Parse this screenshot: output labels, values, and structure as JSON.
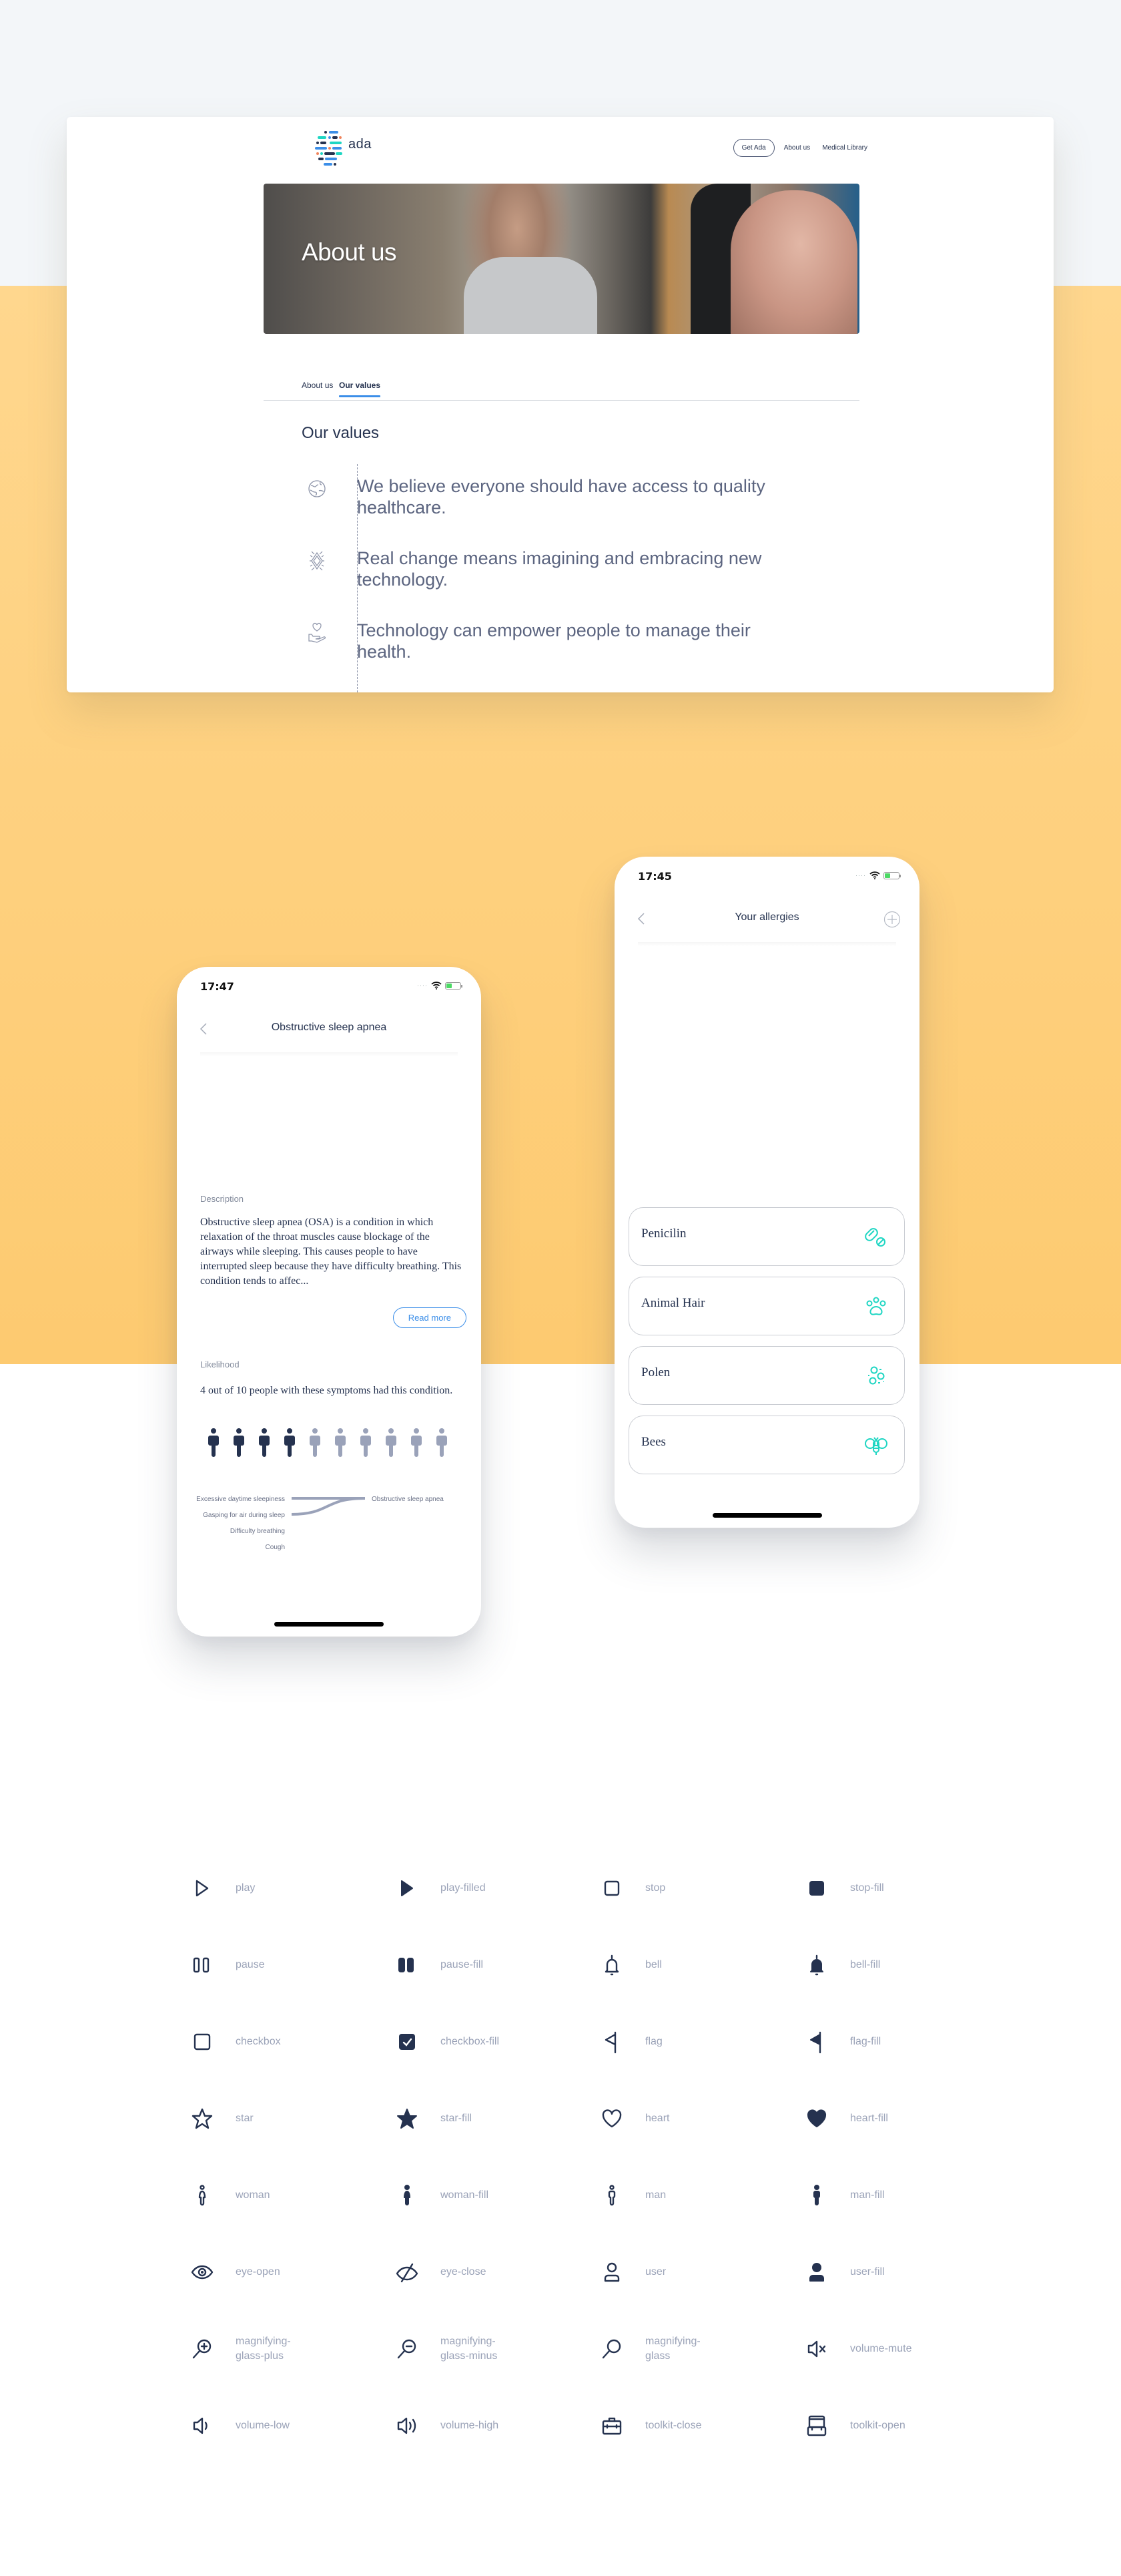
{
  "website": {
    "logo_text": "ada",
    "nav": {
      "get_ada": "Get Ada",
      "about_us": "About us",
      "medical_library": "Medical Library"
    },
    "hero_title": "About us",
    "tabs": [
      {
        "label": "About us",
        "active": false
      },
      {
        "label": "Our values",
        "active": true
      }
    ],
    "section_title": "Our values",
    "values": [
      {
        "icon": "globe-icon",
        "text": "We believe everyone should have access to quality healthcare."
      },
      {
        "icon": "innovation-icon",
        "text": "Real change means imagining and embracing new technology."
      },
      {
        "icon": "hand-heart-icon",
        "text": "Technology can empower people to manage their health."
      }
    ],
    "accent_color": "#3b8ee8"
  },
  "phone_condition": {
    "time": "17:47",
    "title": "Obstructive sleep apnea",
    "description_label": "Description",
    "description": "Obstructive sleep apnea (OSA) is a condition in which relaxation of the throat muscles cause blockage of the airways while sleeping. This causes people to have interrupted sleep because they have difficulty breathing. This condition tends to affec...",
    "read_more": "Read more",
    "likelihood_label": "Likelihood",
    "likelihood_text": "4 out of 10 people with these symptoms had this condition.",
    "likelihood": {
      "affected": 4,
      "total": 10
    },
    "symptoms": [
      "Excessive daytime sleepiness",
      "Gasping for air during sleep",
      "Difficulty breathing",
      "Cough"
    ],
    "linked_symptoms": [
      "Excessive daytime sleepiness",
      "Gasping for air during sleep"
    ],
    "condition": "Obstructive sleep apnea"
  },
  "phone_allergies": {
    "time": "17:45",
    "title": "Your allergies",
    "items": [
      {
        "name": "Penicilin",
        "icon": "pill-icon"
      },
      {
        "name": "Animal Hair",
        "icon": "paw-icon"
      },
      {
        "name": "Polen",
        "icon": "pollen-icon"
      },
      {
        "name": "Bees",
        "icon": "bee-icon"
      }
    ],
    "icon_color": "#1fd6c3"
  },
  "icon_set": [
    "play",
    "play-filled",
    "stop",
    "stop-fill",
    "pause",
    "pause-fill",
    "bell",
    "bell-fill",
    "checkbox",
    "checkbox-fill",
    "flag",
    "flag-fill",
    "star",
    "star-fill",
    "heart",
    "heart-fill",
    "woman",
    "woman-fill",
    "man",
    "man-fill",
    "eye-open",
    "eye-close",
    "user",
    "user-fill",
    "magnifying-glass-plus",
    "magnifying-glass-minus",
    "magnifying-glass",
    "volume-mute",
    "volume-low",
    "volume-high",
    "toolkit-close",
    "toolkit-open"
  ],
  "colors": {
    "brand_navy": "#25324f",
    "orange_band": "#fdca70",
    "label_gray": "#9ba3b8"
  }
}
